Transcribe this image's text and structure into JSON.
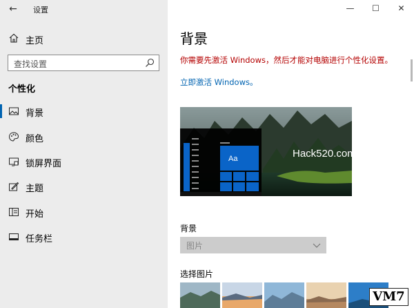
{
  "window": {
    "title": "设置",
    "back_glyph": "←",
    "minimize_glyph": "—",
    "maximize_glyph": "☐",
    "close_glyph": "✕"
  },
  "sidebar": {
    "home_label": "主页",
    "search_placeholder": "查找设置",
    "section_title": "个性化",
    "items": [
      {
        "label": "背景",
        "icon": "picture-icon",
        "active": true
      },
      {
        "label": "颜色",
        "icon": "palette-icon",
        "active": false
      },
      {
        "label": "锁屏界面",
        "icon": "lock-screen-icon",
        "active": false
      },
      {
        "label": "主题",
        "icon": "theme-brush-icon",
        "active": false
      },
      {
        "label": "开始",
        "icon": "start-menu-icon",
        "active": false
      },
      {
        "label": "任务栏",
        "icon": "taskbar-icon",
        "active": false
      }
    ]
  },
  "main": {
    "title": "背景",
    "warning": "你需要先激活 Windows，然后才能对电脑进行个性化设置。",
    "activate_link": "立即激活 Windows。",
    "preview": {
      "tile_label": "Aa",
      "watermark": "Hack520.com"
    },
    "background_label": "背景",
    "background_value": "图片",
    "choose_picture_label": "选择图片"
  },
  "colors": {
    "accent": "#0063b1",
    "warning": "#b40000",
    "sidebar_bg": "#ececec"
  },
  "badge": {
    "text": "VM7"
  }
}
